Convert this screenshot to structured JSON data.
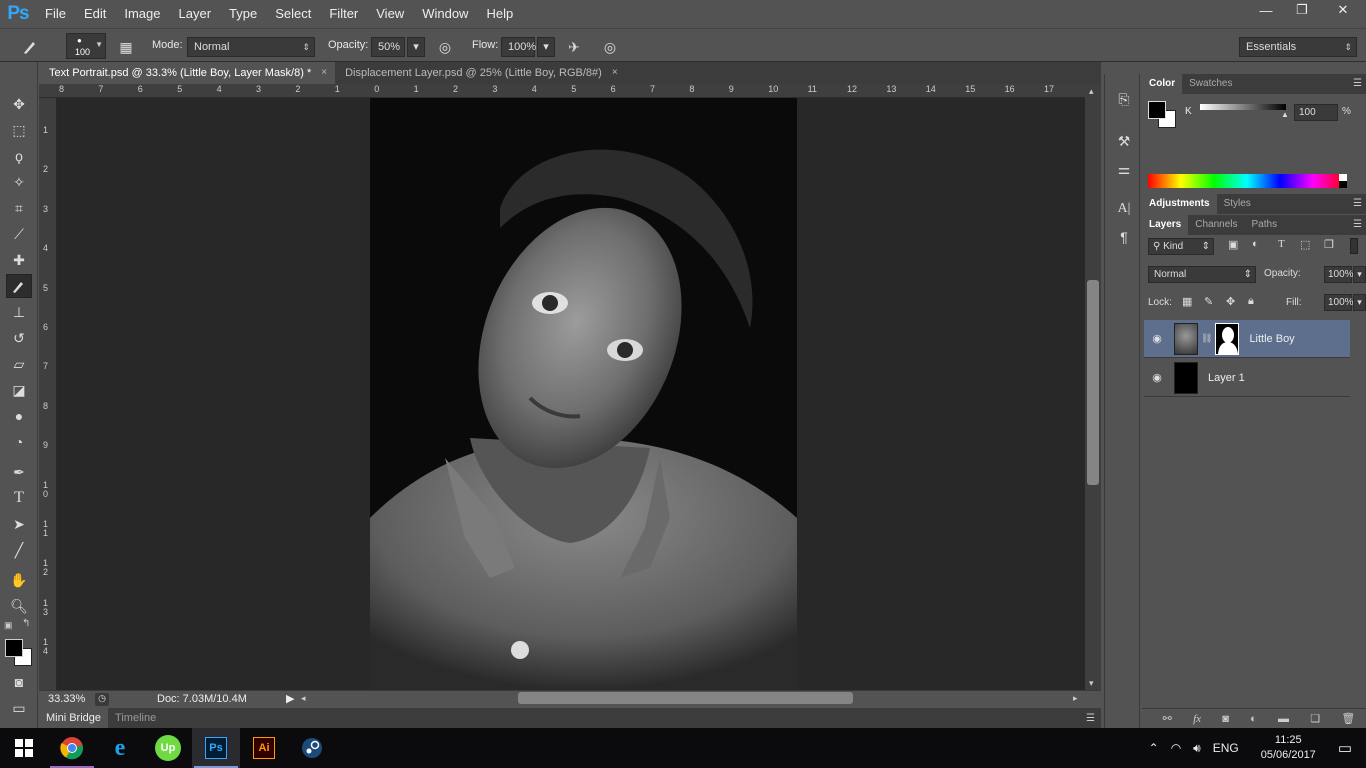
{
  "app": {
    "logo": "Ps"
  },
  "menubar": {
    "items": [
      "File",
      "Edit",
      "Image",
      "Layer",
      "Type",
      "Select",
      "Filter",
      "View",
      "Window",
      "Help"
    ]
  },
  "window_controls": {
    "minimize": "—",
    "restore": "❐",
    "close": "✕"
  },
  "options": {
    "brush_size": "100",
    "mode_label": "Mode:",
    "mode_value": "Normal",
    "opacity_label": "Opacity:",
    "opacity_value": "50%",
    "flow_label": "Flow:",
    "flow_value": "100%",
    "workspace": "Essentials"
  },
  "tabs": [
    {
      "label": "Text Portrait.psd @ 33.3% (Little Boy, Layer Mask/8) *",
      "close": "×"
    },
    {
      "label": "Displacement Layer.psd @ 25% (Little Boy, RGB/8#)",
      "close": "×"
    }
  ],
  "ruler": {
    "h_labels": [
      "8",
      "7",
      "6",
      "5",
      "4",
      "3",
      "2",
      "1",
      "0",
      "1",
      "2",
      "3",
      "4",
      "5",
      "6",
      "7",
      "8",
      "9",
      "10",
      "11",
      "12",
      "13",
      "14",
      "15",
      "16",
      "17"
    ],
    "v_labels": [
      "1",
      "2",
      "3",
      "4",
      "5",
      "6",
      "7",
      "8",
      "9",
      "1 0",
      "1 1",
      "1 2",
      "1 3",
      "1 4"
    ]
  },
  "status": {
    "zoom": "33.33%",
    "doc": "Doc: 7.03M/10.4M"
  },
  "bottom_tabs": [
    "Mini Bridge",
    "Timeline"
  ],
  "color_panel": {
    "tabs": [
      "Color",
      "Swatches"
    ],
    "channel": "K",
    "value": "100",
    "unit": "%"
  },
  "adjustments_panel": {
    "tabs": [
      "Adjustments",
      "Styles"
    ]
  },
  "layers_panel": {
    "tabs": [
      "Layers",
      "Channels",
      "Paths"
    ],
    "filter_kind": "Kind",
    "blend_mode": "Normal",
    "opacity_label": "Opacity:",
    "opacity_value": "100%",
    "lock_label": "Lock:",
    "fill_label": "Fill:",
    "fill_value": "100%",
    "layers": [
      {
        "name": "Little Boy",
        "selected": true
      },
      {
        "name": "Layer 1",
        "selected": false
      }
    ]
  },
  "taskbar": {
    "apps": [
      "windows-start",
      "chrome",
      "internet-explorer",
      "upwork",
      "photoshop",
      "illustrator",
      "steam"
    ],
    "upwork_text": "Up",
    "photoshop_text": "Ps",
    "illustrator_text": "Ai",
    "language": "ENG",
    "time": "11:25",
    "date": "05/06/2017"
  },
  "colors": {
    "ps_blue": "#31a8ff",
    "selection": "#5d6f8d",
    "ai_orange": "#ff9a00"
  }
}
